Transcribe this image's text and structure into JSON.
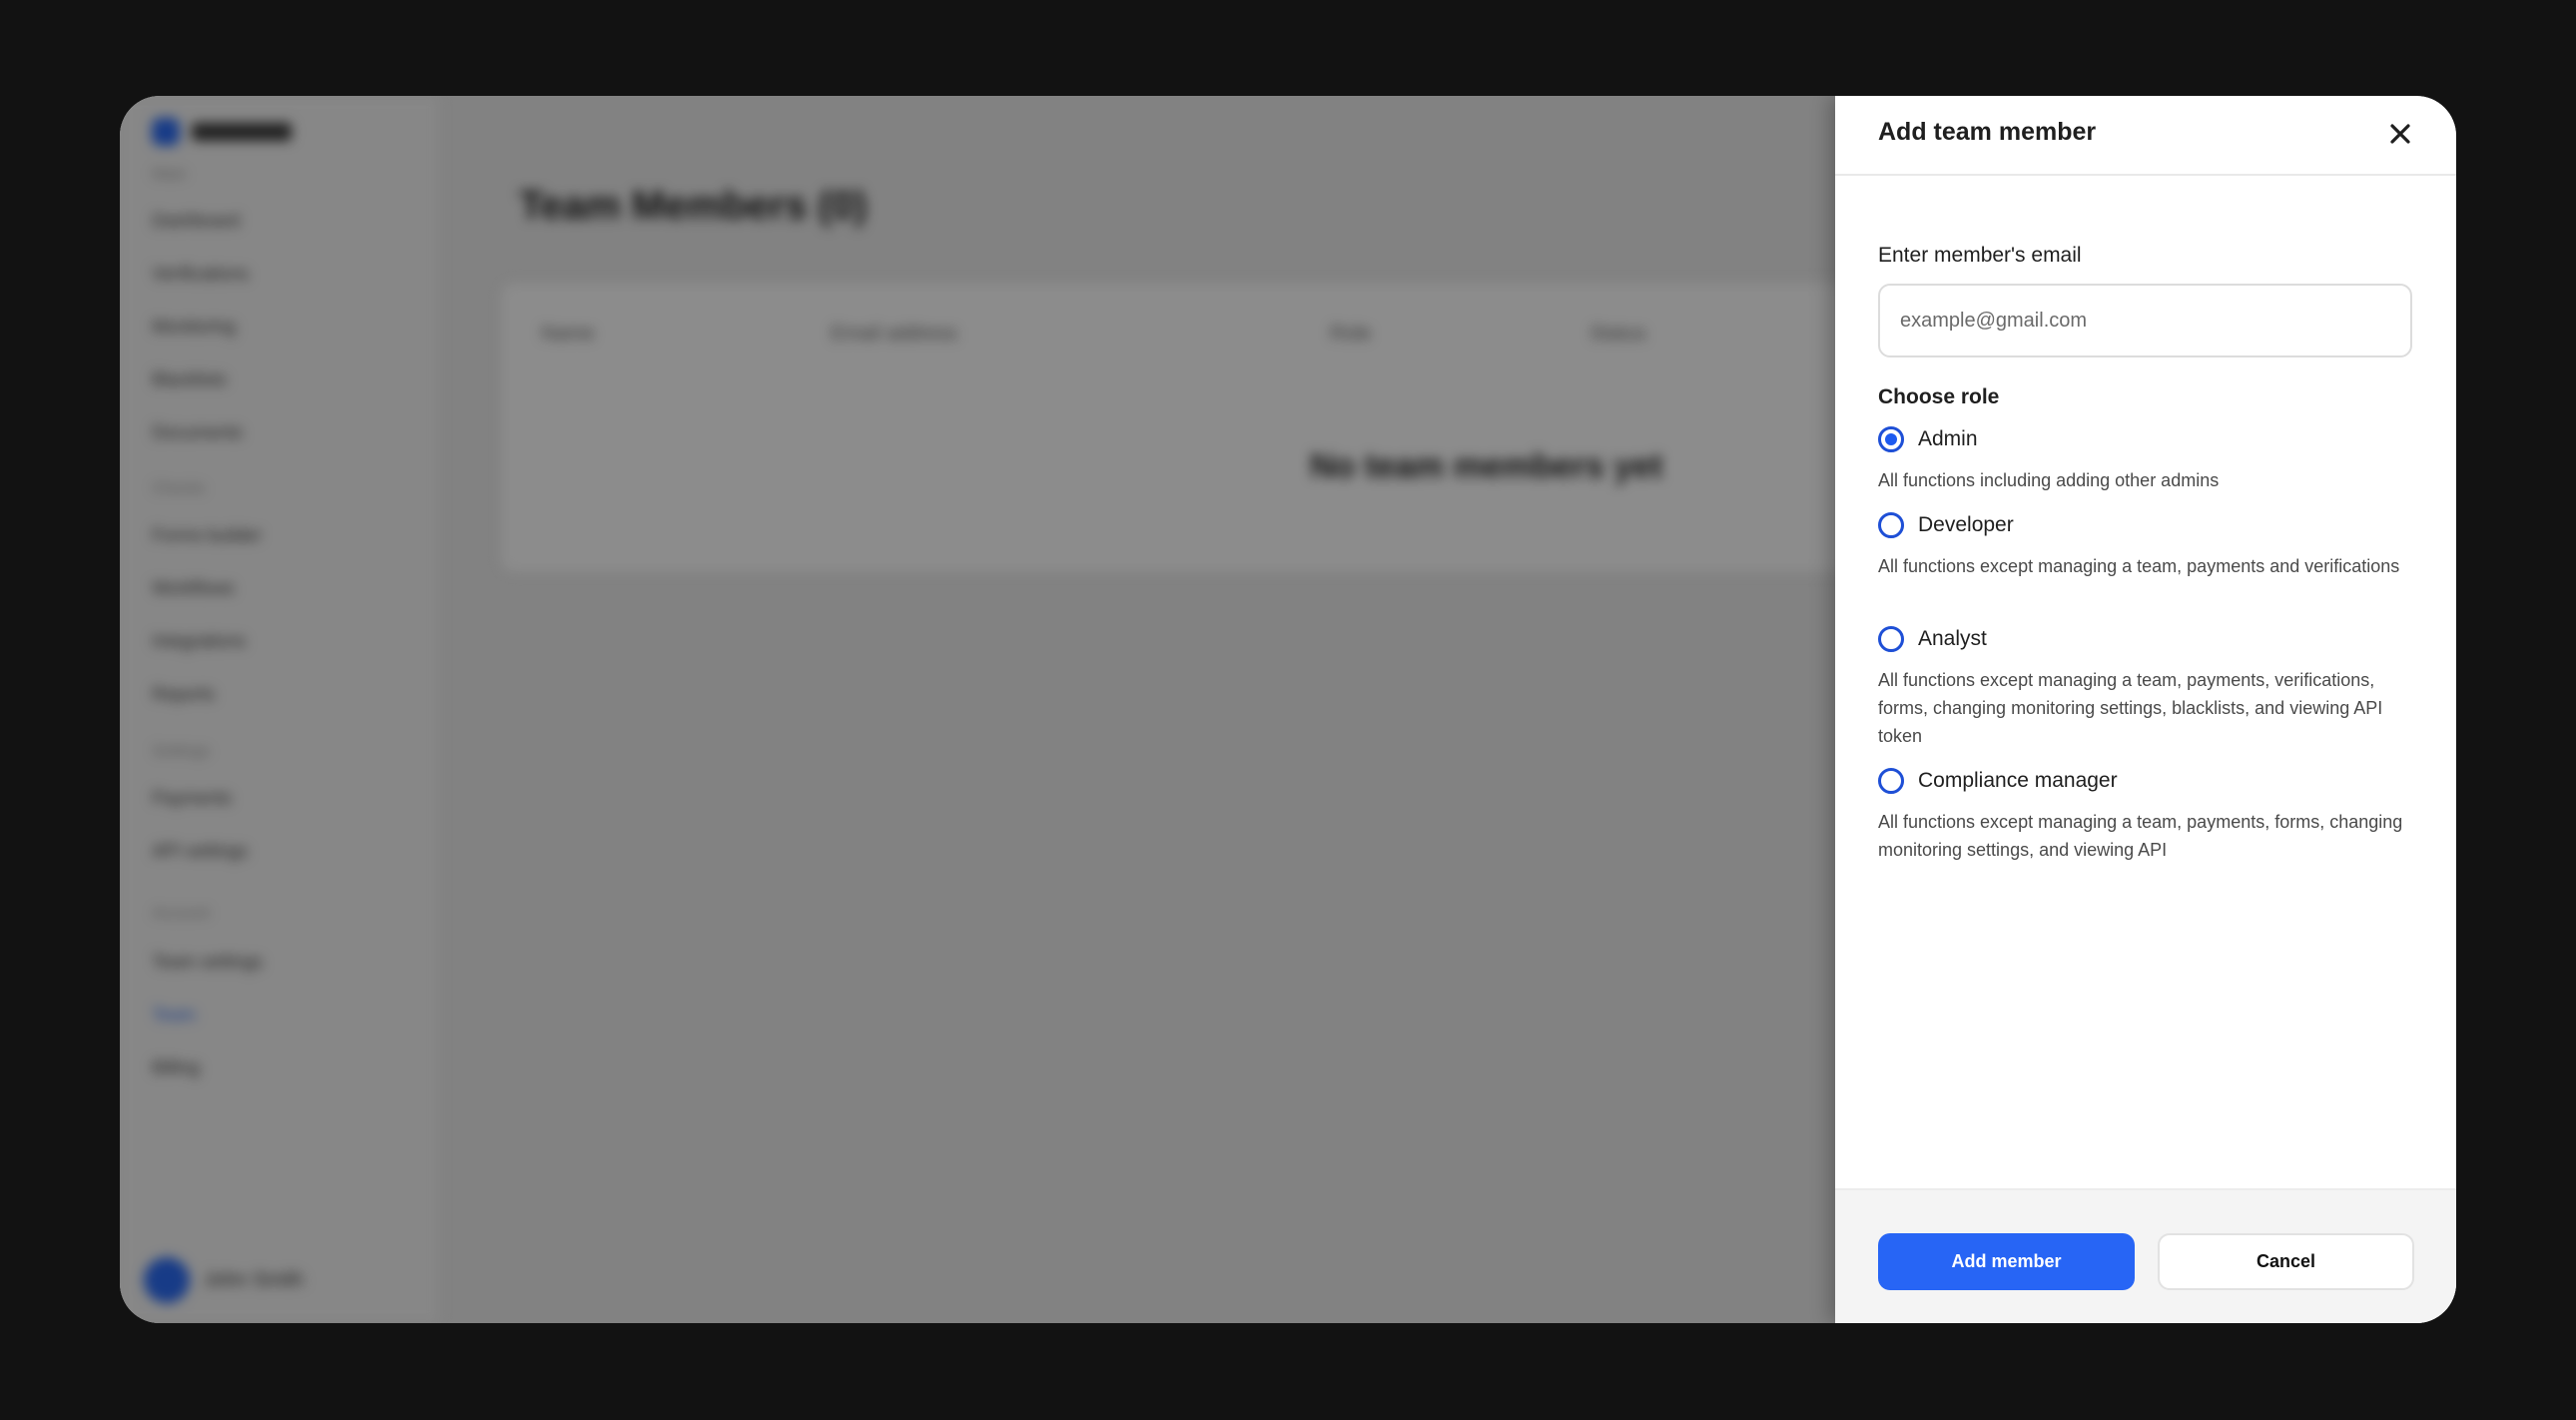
{
  "background": {
    "sidebar_sections": [
      "Main",
      "Checks",
      "Settings",
      "Account"
    ],
    "sidebar_items": [
      "Dashboard",
      "Verifications",
      "Monitoring",
      "Blacklists",
      "Documents",
      "Forms builder",
      "Workflows",
      "Integrations",
      "Reports",
      "Payments",
      "API settings",
      "Team settings",
      "Billing"
    ],
    "active_item": "Team",
    "user_name": "John Smith",
    "page_title": "Team Members (0)",
    "table_headers": [
      "Name",
      "Email address",
      "Role",
      "Status"
    ],
    "empty_message": "No team members yet"
  },
  "drawer": {
    "title": "Add team member",
    "email_label": "Enter member's email",
    "email_placeholder": "example@gmail.com",
    "role_heading": "Choose role",
    "roles": [
      {
        "name": "Admin",
        "description": "All functions including adding other admins",
        "selected": true
      },
      {
        "name": "Developer",
        "description": "All functions except managing a team, payments and verifications",
        "selected": false
      },
      {
        "name": "Analyst",
        "description": "All functions except managing a team, payments, verifications, forms, changing monitoring settings, blacklists, and viewing API token",
        "selected": false
      },
      {
        "name": "Compliance manager",
        "description": "All functions except managing a team, payments, forms, changing monitoring settings, and viewing API",
        "selected": false
      }
    ],
    "primary_button": "Add member",
    "secondary_button": "Cancel"
  },
  "colors": {
    "accent": "#2765f5",
    "radio_border": "#1e4fd6",
    "outer_background": "#121212"
  }
}
